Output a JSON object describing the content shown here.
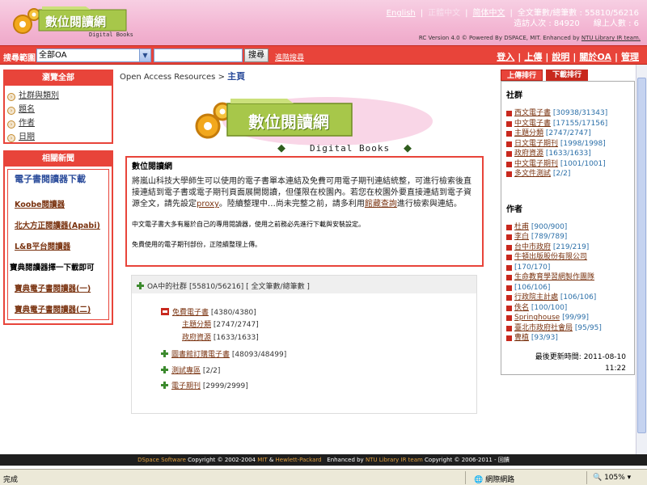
{
  "header": {
    "logo_text": "數位閱讀網",
    "logo_sub": "Digital Books",
    "langs": [
      "English",
      "正體中文",
      "简体中文"
    ],
    "counter_label_1": "全文筆數/總筆數",
    "counter_value_1": "55810/56216",
    "counter_label_2": "造訪人次",
    "counter_value_2": "84920",
    "counter_label_3": "線上人數",
    "counter_value_3": "6",
    "powered_text": "RC Version 4.0 © Powered By DSPACE, MIT. Enhanced by",
    "powered_link": "NTU Library IR team."
  },
  "search": {
    "label": "搜尋範圍",
    "scope_value": "全部OA",
    "input_value": "",
    "button": "搜尋",
    "advanced": "進階搜尋"
  },
  "mainnav": [
    "登入",
    "上傳",
    "說明",
    "關於OA",
    "管理"
  ],
  "browse": {
    "title": "瀏覽全部",
    "items": [
      "社群與類別",
      "題名",
      "作者",
      "日期"
    ]
  },
  "news": {
    "title": "相關新聞",
    "heading": "電子書閱讀器下載",
    "items": [
      "Koobe閱讀器",
      "北大方正閱讀器(Apabi)",
      "L&B平台閱讀器",
      "寶典閱讀器擇一下載即可",
      "寶典電子書閱讀器(一)",
      "寶典電子書閱讀器(二)"
    ]
  },
  "breadcrumb": {
    "root": "Open Access Resources",
    "sep": ">",
    "current": "主頁"
  },
  "hero": {
    "title": "數位閱讀網",
    "sub": "Digital Books"
  },
  "intro": {
    "title": "數位閱讀網",
    "p1_a": "將嵐山科技大學師生可以使用的電子書單本連結及免費可用電子期刊連結統整，可進行檢索後直接連結到電子書或電子期刊頁面展開閱讀，但僅限在校園內。若您在校園外要直接連結到電子資源全文，請先設定",
    "p1_link1": "proxy",
    "p1_b": "。陸續整理中…尚未完整之前，請多利用",
    "p1_link2": "館藏查詢",
    "p1_c": "進行檢索與連結。",
    "p2": "中文電子書大多有屬於自己的專用閱讀器，使用之前務必先進行下載與安裝設定。",
    "p3": "免費使用的電子期刊部份，正陸續整理上傳。"
  },
  "tree": {
    "head_label": "OA中的社群",
    "head_count": "[55810/56216]",
    "head_note": "[ 全文筆數/總筆數 ]",
    "rows": [
      {
        "label": "免費電子書",
        "count": "[4380/4380]"
      },
      {
        "label": "主題分類",
        "count": "[2747/2747]"
      },
      {
        "label": "政府資源",
        "count": "[1633/1633]"
      },
      {
        "label": "圖書館訂購電子書",
        "count": "[48093/48499]"
      },
      {
        "label": "測試專區",
        "count": "[2/2]"
      },
      {
        "label": "電子期刊",
        "count": "[2999/2999]"
      }
    ]
  },
  "rank": {
    "tab_upload": "上傳排行",
    "tab_download": "下載排行",
    "community_title": "社群",
    "community": [
      {
        "label": "西文電子書",
        "count": "[30938/31343]"
      },
      {
        "label": "中文電子書",
        "count": "[17155/17156]"
      },
      {
        "label": "主題分類",
        "count": "[2747/2747]"
      },
      {
        "label": "日文電子期刊",
        "count": "[1998/1998]"
      },
      {
        "label": "政府資源",
        "count": "[1633/1633]"
      },
      {
        "label": "中文電子期刊",
        "count": "[1001/1001]"
      },
      {
        "label": "多文件測試",
        "count": "[2/2]"
      }
    ],
    "author_title": "作者",
    "authors": [
      {
        "label": "杜甫",
        "count": "[900/900]"
      },
      {
        "label": "李白",
        "count": "[789/789]"
      },
      {
        "label": "台中市政府",
        "count": "[219/219]"
      },
      {
        "label": "牛頓出版股份有限公司",
        "count": ""
      },
      {
        "label": "",
        "count": "[170/170]"
      },
      {
        "label": "生命教育學習網製作團隊",
        "count": ""
      },
      {
        "label": "",
        "count": "[106/106]"
      },
      {
        "label": "行政院主計處",
        "count": "[106/106]"
      },
      {
        "label": "佚名",
        "count": "[100/100]"
      },
      {
        "label": "Springhouse",
        "count": "[99/99]"
      },
      {
        "label": "臺北市政府社會局",
        "count": "[95/95]"
      },
      {
        "label": "曹植",
        "count": "[93/93]"
      }
    ],
    "updated_label": "最後更新時間:",
    "updated_date": "2011-08-10",
    "updated_time": "11:22"
  },
  "footer": {
    "a": "DSpace Software",
    "b": "Copyright © 2002-2004",
    "c": "MIT",
    "d": "&",
    "e": "Hewlett-Packard",
    "f": "Enhanced by",
    "g": "NTU Library IR team",
    "h": "Copyright © 2006-2011",
    "i": "- 回饋"
  },
  "status": {
    "done": "完成",
    "zone": "網際網路",
    "zoom": "105%"
  },
  "colors": {
    "accent_red": "#e8443a",
    "header_pink": "#f3b6d3",
    "link_brown": "#7a3310",
    "count_blue": "#2b6fa8"
  }
}
